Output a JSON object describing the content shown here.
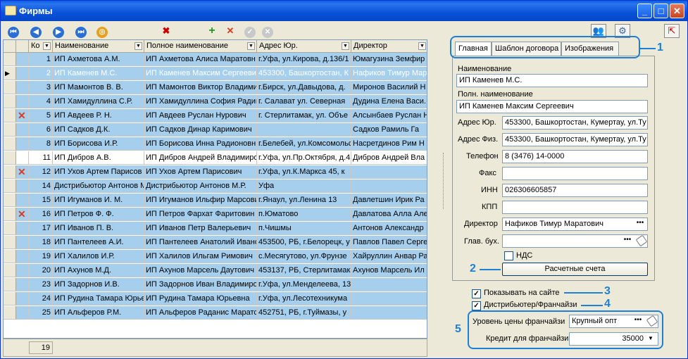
{
  "window": {
    "title": "Фирмы"
  },
  "grid": {
    "headers": [
      "Ко",
      "Наименование",
      "Полное наименование",
      "Адрес Юр.",
      "Директор"
    ],
    "rows": [
      {
        "n": "1",
        "name": "ИП Ахметова А.М.",
        "full": "ИП Ахметова Алиса Маратовн",
        "addr": "г.Уфа, ул.Кирова, д.136/1",
        "dir": "Юмагузина Земфир",
        "style": "blue",
        "mark": ""
      },
      {
        "n": "2",
        "name": "ИП Каменев М.С.",
        "full": "ИП Каменев Максим Сергеевич",
        "addr": "453300, Башкортостан, К",
        "dir": "Нафиков Тимур Мар",
        "style": "sel",
        "mark": ""
      },
      {
        "n": "3",
        "name": "ИП Мамонтов В. В.",
        "full": "ИП Мамонтов Виктор Владими",
        "addr": "г.Бирск, ул.Давыдова, д.",
        "dir": "Миронов Василий Н",
        "style": "blue",
        "mark": ""
      },
      {
        "n": "4",
        "name": "ИП Хамидуллина С.Р.",
        "full": "ИП Хамидуллина София Радик",
        "addr": "г. Салават  ул. Северная",
        "dir": "Дудина Елена Васи.",
        "style": "blue",
        "mark": ""
      },
      {
        "n": "5",
        "name": "ИП Авдеев Р. Н.",
        "full": "ИП Авдеев Руслан Нурович",
        "addr": "г. Стерлитамак, ул. Объе",
        "dir": "Алсынбаев Руслан Н",
        "style": "blue",
        "mark": "x"
      },
      {
        "n": "6",
        "name": "ИП Садков Д.К.",
        "full": "ИП Садков Динар Каримович",
        "addr": "",
        "dir": "Садков Рамиль Га",
        "style": "blue",
        "mark": ""
      },
      {
        "n": "8",
        "name": "ИП Борисова И.Р.",
        "full": "ИП Борисова Инна Радионовн",
        "addr": "г.Белебей, ул.Комсомольс",
        "dir": "Насретдинов Рим Н",
        "style": "blue",
        "mark": ""
      },
      {
        "n": "11",
        "name": "ИП Дибров А.В.",
        "full": "ИП Дибров Андрей Владимиро",
        "addr": "г.Уфа, ул.Пр.Октября, д.4",
        "dir": "Дибров Андрей Вла",
        "style": "white",
        "mark": ""
      },
      {
        "n": "12",
        "name": "ИП Ухов Артем Парисов",
        "full": "ИП Ухов Артем Парисович",
        "addr": "г.Уфа, ул.К.Маркса 45, к",
        "dir": "",
        "style": "blue",
        "mark": "x"
      },
      {
        "n": "14",
        "name": "Дистрибьютор Антонов М",
        "full": "Дистрибьютор Антонов М.Р.",
        "addr": "Уфа",
        "dir": "",
        "style": "blue",
        "mark": ""
      },
      {
        "n": "15",
        "name": "ИП Игуманов И. М.",
        "full": "ИП Игуманов Ильфир Марсови",
        "addr": "г.Янаул, ул.Ленина 13",
        "dir": "Давлетшин Ирик Ра",
        "style": "blue",
        "mark": ""
      },
      {
        "n": "16",
        "name": "ИП Петров Ф. Ф.",
        "full": "ИП Петров Фархат Фаритовин",
        "addr": "п.Юматово",
        "dir": "Давлатова Алла Але",
        "style": "blue",
        "mark": "x"
      },
      {
        "n": "17",
        "name": "ИП Иванов П. В.",
        "full": "ИП Иванов Петр Валерьевич",
        "addr": "п.Чишмы",
        "dir": "Антонов Александр",
        "style": "blue",
        "mark": ""
      },
      {
        "n": "18",
        "name": "ИП Пантелеев А.И.",
        "full": "ИП Пантелеев Анатолий Ивано",
        "addr": "453500, РБ, г.Белорецк, у",
        "dir": "Павлов Павел Серге",
        "style": "blue",
        "mark": ""
      },
      {
        "n": "19",
        "name": "ИП Халилов И.Р.",
        "full": "ИП Халилов Ильгам Римович",
        "addr": "с.Месягутово, ул.Фрунзе",
        "dir": "Хайруллин Анвар Ра",
        "style": "blue",
        "mark": ""
      },
      {
        "n": "20",
        "name": "ИП Ахунов М.Д.",
        "full": "ИП Ахунов Марсель Даутович",
        "addr": "453137, РБ, Стерлитамак",
        "dir": "Ахунов Марсель Ил",
        "style": "blue",
        "mark": ""
      },
      {
        "n": "23",
        "name": "ИП Задорнов И.В.",
        "full": "ИП Задорнов Иван Владимиров",
        "addr": "г.Уфа, ул.Менделеева, 135",
        "dir": "",
        "style": "blue",
        "mark": ""
      },
      {
        "n": "24",
        "name": "ИП Рудина Тамара Юрье",
        "full": "ИП Рудина Тамара Юрьевна",
        "addr": "г.Уфа, ул.Лесотехникума",
        "dir": "",
        "style": "blue",
        "mark": ""
      },
      {
        "n": "25",
        "name": "ИП Альферов Р.М.",
        "full": "ИП Альферов Раданис Маратс",
        "addr": "452751, РБ, г.Туймазы, у",
        "dir": "",
        "style": "blue",
        "mark": ""
      }
    ],
    "footer_count": "19"
  },
  "tabs": [
    "Главная",
    "Шаблон договора",
    "Изображения"
  ],
  "form": {
    "name_label": "Наименование",
    "name_value": "ИП Каменев М.С.",
    "fullname_label": "Полн. наименование",
    "fullname_value": "ИП Каменев Максим Сергеевич",
    "addr_legal_label": "Адрес Юр.",
    "addr_legal_value": "453300, Башкортостан, Кумертау, ул.Ту",
    "addr_phys_label": "Адрес Физ.",
    "addr_phys_value": "453300, Башкортостан, Кумертау, ул.Ту",
    "phone_label": "Телефон",
    "phone_value": "8 (3476) 14-0000",
    "fax_label": "Факс",
    "fax_value": "",
    "inn_label": "ИНН",
    "inn_value": "026306605857",
    "kpp_label": "КПП",
    "kpp_value": "",
    "director_label": "Директор",
    "director_value": "Нафиков Тимур Маратович",
    "chief_acc_label": "Глав. бух.",
    "chief_acc_value": "",
    "vat_label": "НДС",
    "accounts_button": "Расчетные счета"
  },
  "options": {
    "show_on_site": "Показывать на сайте",
    "distributor": "Дистрибьютер/Франчайзи",
    "price_level_label": "Уровень цены франчайзи",
    "price_level_value": "Крупный опт",
    "credit_label": "Кредит для франчайзи",
    "credit_value": "35000"
  },
  "callouts": [
    "1",
    "2",
    "3",
    "4",
    "5"
  ],
  "colors": {
    "row_blue": "#a6cfee",
    "highlight": "#1e7fd6",
    "title_bar": "#0851d8"
  }
}
